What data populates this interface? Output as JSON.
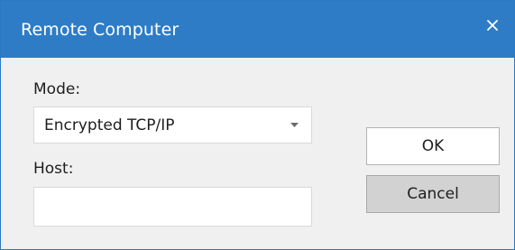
{
  "window": {
    "title": "Remote Computer",
    "close_glyph": "✕",
    "titlebar_color": "#2e7cc6"
  },
  "form": {
    "mode_label": "Mode:",
    "mode_value": "Encrypted TCP/IP",
    "host_label": "Host:",
    "host_value": "",
    "host_placeholder": ""
  },
  "buttons": {
    "ok_label": "OK",
    "cancel_label": "Cancel"
  },
  "icons": {
    "close": "close-icon",
    "dropdown": "chevron-down-icon"
  }
}
